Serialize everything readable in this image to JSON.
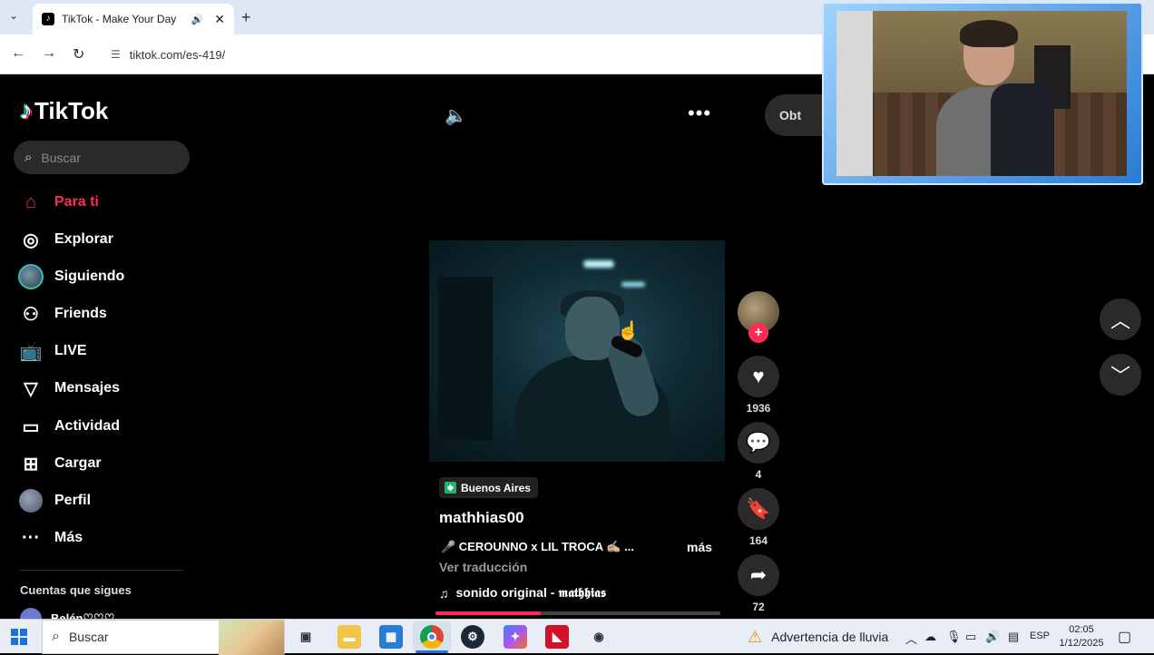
{
  "browser": {
    "tab_title": "TikTok - Make Your Day",
    "url": "tiktok.com/es-419/"
  },
  "tiktok": {
    "logo_text": "TikTok",
    "search_placeholder": "Buscar",
    "nav": [
      {
        "label": "Para ti",
        "icon": "home-icon",
        "active": true
      },
      {
        "label": "Explorar",
        "icon": "compass-icon"
      },
      {
        "label": "Siguiendo",
        "icon": "following-avatar"
      },
      {
        "label": "Friends",
        "icon": "friends-icon"
      },
      {
        "label": "LIVE",
        "icon": "live-tv-icon"
      },
      {
        "label": "Mensajes",
        "icon": "send-icon"
      },
      {
        "label": "Actividad",
        "icon": "inbox-icon"
      },
      {
        "label": "Cargar",
        "icon": "upload-plus-icon"
      },
      {
        "label": "Perfil",
        "icon": "profile-avatar"
      },
      {
        "label": "Más",
        "icon": "more-dots-icon"
      }
    ],
    "following_title": "Cuentas que sigues",
    "following_first": "Belén♡♡♡",
    "get_app_label": "Obt",
    "video": {
      "location": "Buenos Aires",
      "username": "mathhias00",
      "description": "🎤 CEROUNNO x LIL TROCA ✍🏼 ...",
      "more_label": "más",
      "translate_label": "Ver traducción",
      "sound": "sonido original - 𝖒𝖆𝖙𝖍𝖍𝖎𝖆𝖘",
      "progress": 0.37
    },
    "actions": {
      "likes": "1936",
      "comments": "4",
      "saves": "164",
      "shares": "72"
    },
    "accent_color": "#fe2c55"
  },
  "taskbar": {
    "search_placeholder": "Buscar",
    "weather": "Advertencia de lluvia",
    "language": "ESP",
    "time": "02:05",
    "date": "1/12/2025"
  }
}
